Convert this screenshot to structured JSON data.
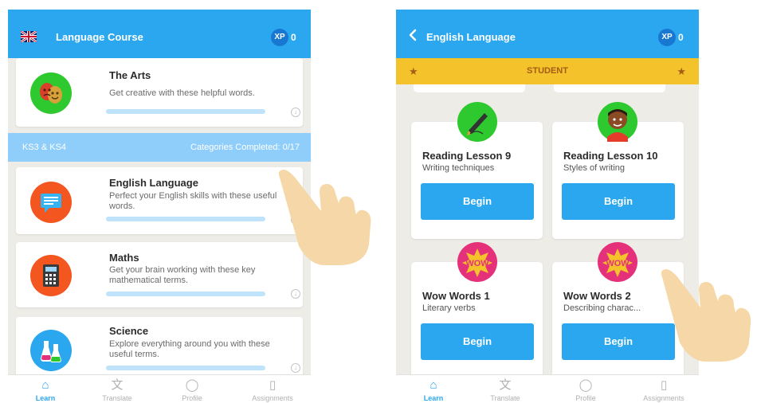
{
  "left_screen": {
    "header": {
      "title": "Language Course",
      "xp_badge": "XP",
      "xp_value": "0"
    },
    "cards": [
      {
        "title": "The Arts",
        "description": "Get creative with these helpful words.",
        "icon": "theatre-masks-icon"
      },
      {
        "title": "English Language",
        "description": "Perfect your English skills with these useful words.",
        "icon": "chat-bubble-icon"
      },
      {
        "title": "Maths",
        "description": "Get your brain working with these key mathematical terms.",
        "icon": "calculator-icon"
      },
      {
        "title": "Science",
        "description": "Explore everything around you with these useful terms.",
        "icon": "flasks-icon"
      }
    ],
    "section": {
      "left": "KS3 & KS4",
      "right": "Categories Completed: 0/17"
    }
  },
  "right_screen": {
    "header": {
      "title": "English Language",
      "xp_badge": "XP",
      "xp_value": "0"
    },
    "student_bar": "STUDENT",
    "lessons": [
      {
        "title": "Reading Lesson 9",
        "subtitle": "Writing techniques",
        "button": "Begin",
        "icon": "pen-icon"
      },
      {
        "title": "Reading Lesson 10",
        "subtitle": "Styles of writing",
        "button": "Begin",
        "icon": "boy-avatar-icon"
      },
      {
        "title": "Wow Words 1",
        "subtitle": "Literary verbs",
        "button": "Begin",
        "icon": "wow-badge-icon"
      },
      {
        "title": "Wow Words 2",
        "subtitle": "Describing charac...",
        "button": "Begin",
        "icon": "wow-badge-icon"
      }
    ]
  },
  "nav": [
    {
      "label": "Learn",
      "icon": "home-icon",
      "active": true
    },
    {
      "label": "Translate",
      "icon": "translate-icon",
      "active": false
    },
    {
      "label": "Profile",
      "icon": "profile-icon",
      "active": false
    },
    {
      "label": "Assignments",
      "icon": "book-icon",
      "active": false
    }
  ],
  "colors": {
    "primary": "#2ba7ef",
    "xp_badge": "#1878d1",
    "student_bar": "#f4c22b",
    "section_bar": "#8fcdfa",
    "background": "#eeece7"
  }
}
